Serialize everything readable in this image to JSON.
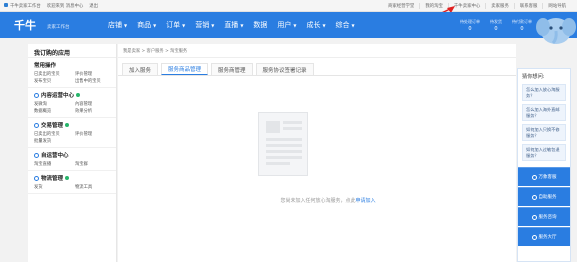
{
  "topbar": {
    "left": [
      "千牛卖家工作台",
      "欢迎来到 消息中心",
      "退出"
    ],
    "right": [
      "商家经营学堂",
      "我的淘宝",
      "千牛卖家中心",
      "卖家服务",
      "联系客服",
      "网站导航"
    ]
  },
  "nav": {
    "logo": "千牛",
    "store": "卖家工作台",
    "menu": [
      "店铺",
      "商品",
      "订单",
      "营销",
      "直播",
      "数据",
      "用户",
      "成长",
      "综合"
    ],
    "stats": [
      {
        "label": "待处理订单",
        "value": "0"
      },
      {
        "label": "待发货",
        "value": "0"
      },
      {
        "label": "待付款订单",
        "value": "0"
      }
    ]
  },
  "sidebar": {
    "title": "我订购的应用",
    "sections": [
      {
        "heading": "常用操作",
        "rows": [
          [
            "已卖出的宝贝",
            "评价管理"
          ],
          [
            "发布宝贝",
            "出售中的宝贝"
          ]
        ]
      },
      {
        "heading": "内容运营中心",
        "rows": [
          [
            "发微淘",
            "內容管理"
          ],
          [
            "数据概览",
            "效果分析"
          ]
        ]
      },
      {
        "heading": "交易管理",
        "rows": [
          [
            "已卖出的宝贝",
            "评价管理"
          ],
          [
            "批量发货"
          ]
        ]
      },
      {
        "heading": "自运营中心",
        "rows": [
          [
            "淘宝直播",
            "淘宝群"
          ]
        ]
      },
      {
        "heading": "物流管理",
        "rows": [
          [
            "发货",
            "物流工具"
          ]
        ]
      }
    ]
  },
  "main": {
    "breadcrumb": "我是卖家 > 客户服务 > 淘宝服务",
    "tabs": [
      "加入服务",
      "服务商品管理",
      "服务商管理",
      "服务协议签署记录"
    ],
    "active_tab": 1,
    "empty_text": "您尚未加入任何放心淘服务，点此",
    "empty_link": "申请加入"
  },
  "helper": {
    "title": "猜你想问:",
    "questions": [
      "怎么加入放心淘服务？",
      "怎么加入海外直邮服务？",
      "如何加入只换不修服务？",
      "如何加入过敏包退服务？"
    ],
    "buttons": [
      "万象客服",
      "自助服务",
      "服务咨询",
      "服务大厅"
    ]
  },
  "colors": {
    "brand": "#2a7de1",
    "accent_link": "#2a7de1"
  }
}
